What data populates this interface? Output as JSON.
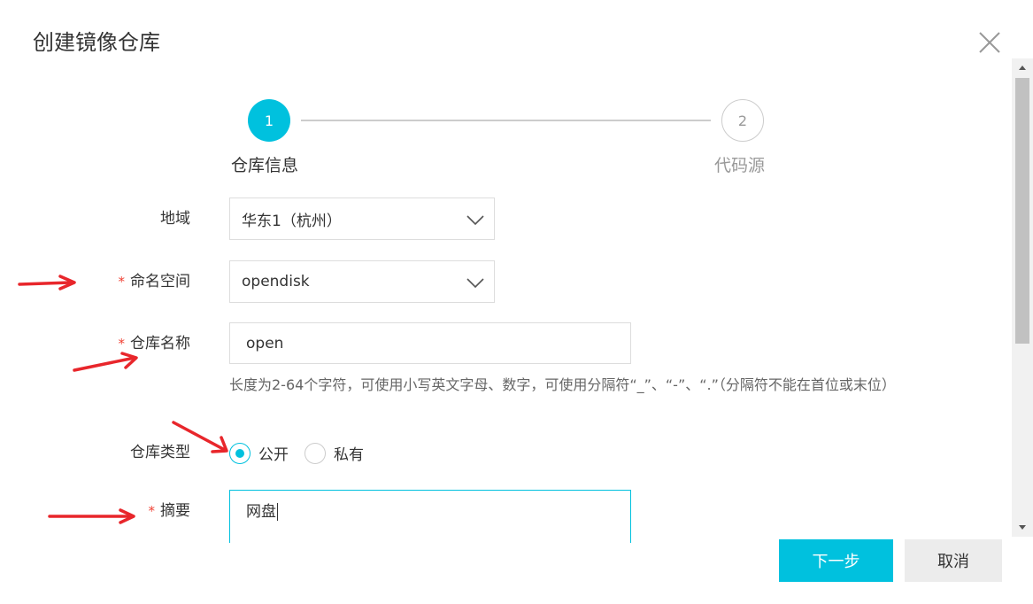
{
  "dialog": {
    "title": "创建镜像仓库"
  },
  "steps": [
    {
      "number": "1",
      "label": "仓库信息",
      "state": "active"
    },
    {
      "number": "2",
      "label": "代码源",
      "state": "inactive"
    }
  ],
  "form": {
    "region": {
      "label": "地域",
      "value": "华东1（杭州）"
    },
    "namespace": {
      "label": "命名空间",
      "required_mark": "*",
      "value": "opendisk"
    },
    "repo_name": {
      "label": "仓库名称",
      "required_mark": "*",
      "value": "open",
      "hint": "长度为2-64个字符，可使用小写英文字母、数字，可使用分隔符“_”、“-”、“.”（分隔符不能在首位或末位）"
    },
    "repo_type": {
      "label": "仓库类型",
      "options": [
        "公开",
        "私有"
      ],
      "selected": "公开"
    },
    "summary": {
      "label": "摘要",
      "required_mark": "*",
      "value": "网盘"
    }
  },
  "buttons": {
    "next": "下一步",
    "cancel": "取消"
  },
  "colors": {
    "accent": "#00c1de",
    "required": "#f04134",
    "annotation_arrow": "#e8262b"
  }
}
